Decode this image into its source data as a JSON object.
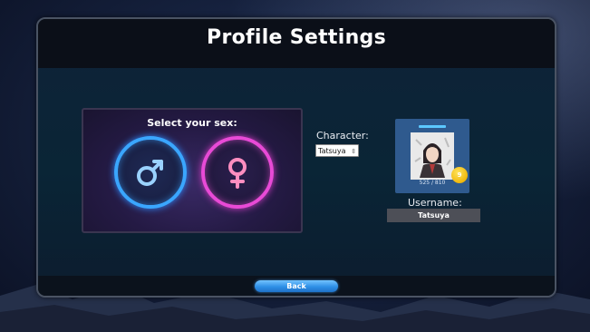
{
  "title": "Profile Settings",
  "sex_select": {
    "heading": "Select your sex:",
    "options": [
      {
        "name": "male",
        "icon": "male-symbol-icon",
        "color": "#3aa6ff"
      },
      {
        "name": "female",
        "icon": "female-symbol-icon",
        "color": "#e84ad6"
      }
    ]
  },
  "character": {
    "label": "Character:",
    "selected": "Tatsuya"
  },
  "profile_card": {
    "xp": "525 / 810",
    "level": "9"
  },
  "username": {
    "label": "Username:",
    "value": "Tatsuya"
  },
  "buttons": {
    "back": "Back"
  },
  "colors": {
    "accent_blue": "#2e8fe6",
    "level_gold": "#f1b80c"
  }
}
